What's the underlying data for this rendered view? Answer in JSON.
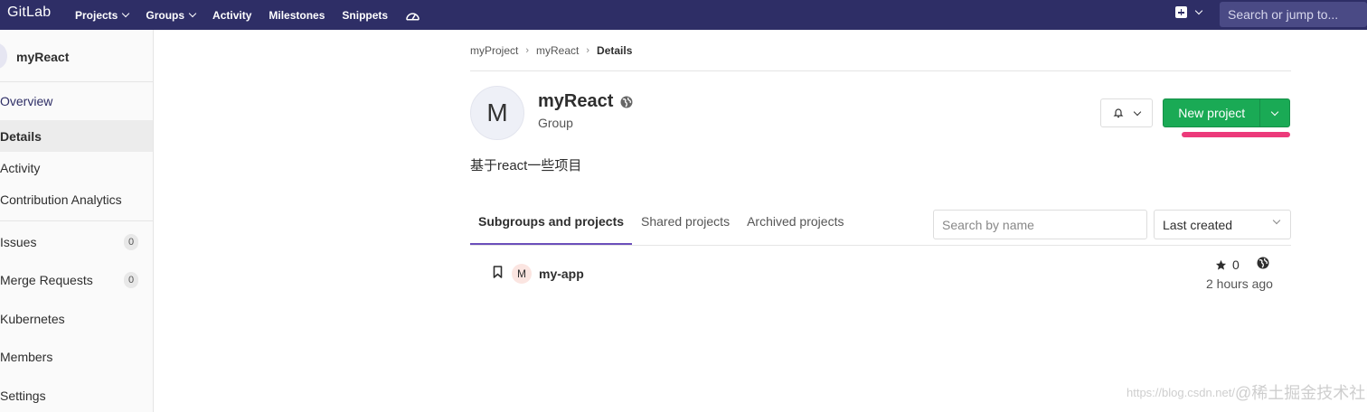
{
  "nav": {
    "brand": "GitLab",
    "links": [
      "Projects",
      "Groups",
      "Activity",
      "Milestones",
      "Snippets"
    ],
    "search_placeholder": "Search or jump to..."
  },
  "sidebar": {
    "title": "myReact",
    "items": [
      {
        "label": "Overview"
      },
      {
        "label": "Details"
      },
      {
        "label": "Activity"
      },
      {
        "label": "Contribution Analytics"
      },
      {
        "label": "Issues",
        "count": "0"
      },
      {
        "label": "Merge Requests",
        "count": "0"
      },
      {
        "label": "Kubernetes"
      },
      {
        "label": "Members"
      },
      {
        "label": "Settings"
      }
    ]
  },
  "breadcrumb": [
    "myProject",
    "myReact",
    "Details"
  ],
  "group": {
    "avatar_letter": "M",
    "name": "myReact",
    "type": "Group",
    "description": "基于react一些项目"
  },
  "actions": {
    "new_project": "New project"
  },
  "tabs": [
    "Subgroups and projects",
    "Shared projects",
    "Archived projects"
  ],
  "filter": {
    "search_placeholder": "Search by name",
    "sort_selected": "Last created"
  },
  "projects": [
    {
      "avatar_letter": "M",
      "name": "my-app",
      "stars": "0",
      "updated": "2 hours ago"
    }
  ],
  "watermark": {
    "url": "https://blog.csdn.net/",
    "text": "@稀土掘金技术社区"
  },
  "colors": {
    "nav_bg": "#2e2e66",
    "primary_green": "#1aaa55",
    "active_tab": "#6b4fbb",
    "highlight_mark": "#ec3a7a"
  }
}
